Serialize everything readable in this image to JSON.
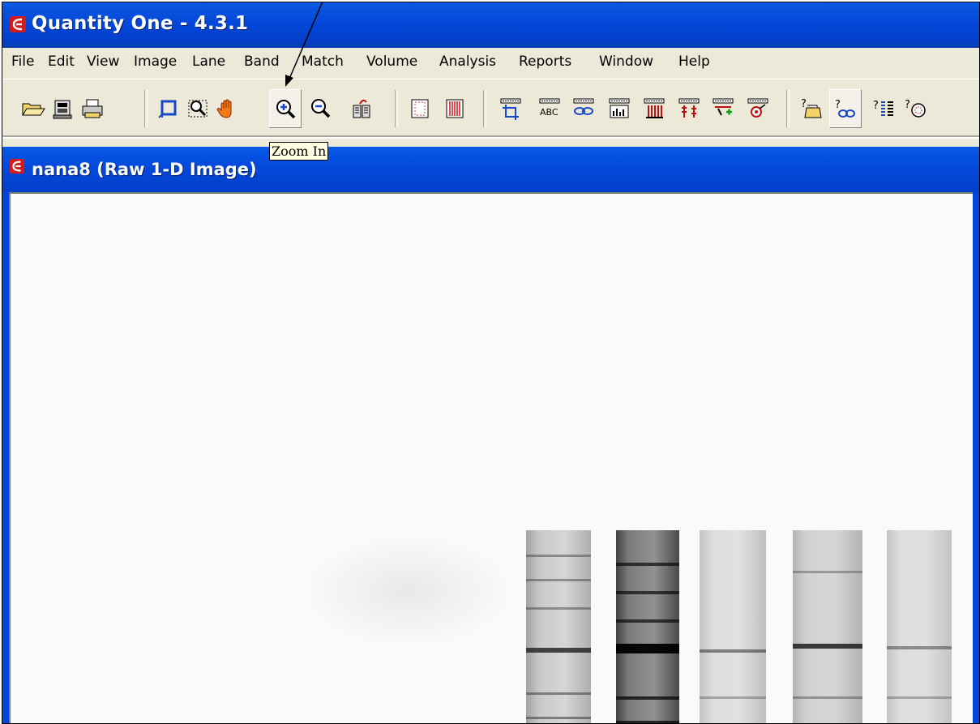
{
  "app": {
    "title": "Quantity One - 4.3.1"
  },
  "menu": {
    "items": [
      "File",
      "Edit",
      "View",
      "Image",
      "Lane",
      "Band",
      "Match",
      "Volume",
      "Analysis",
      "Reports",
      "Window",
      "Help"
    ]
  },
  "toolbar": {
    "buttons": [
      "open-icon",
      "scanner-icon",
      "print-icon",
      "crop-icon",
      "magnifier-select-icon",
      "hand-grab-icon",
      "zoom-in-icon",
      "zoom-out-icon",
      "image-stack-icon",
      "lane-frame-icon",
      "lane-grid-icon",
      "frame-crop-icon",
      "frame-abc-icon",
      "frame-link-icon",
      "frame-histogram-icon",
      "frame-bars-icon",
      "frame-red-bands-icon",
      "frame-add-icon",
      "frame-target-icon",
      "help-folder-icon",
      "help-link-icon",
      "help-list-icon",
      "help-dial-icon"
    ],
    "tooltip": "Zoom In"
  },
  "document": {
    "title": "nana8 (Raw 1-D Image)"
  },
  "colors": {
    "titlebar": "#0446d8",
    "tooltip_bg": "#ffffe1",
    "chrome": "#ece9d8"
  }
}
